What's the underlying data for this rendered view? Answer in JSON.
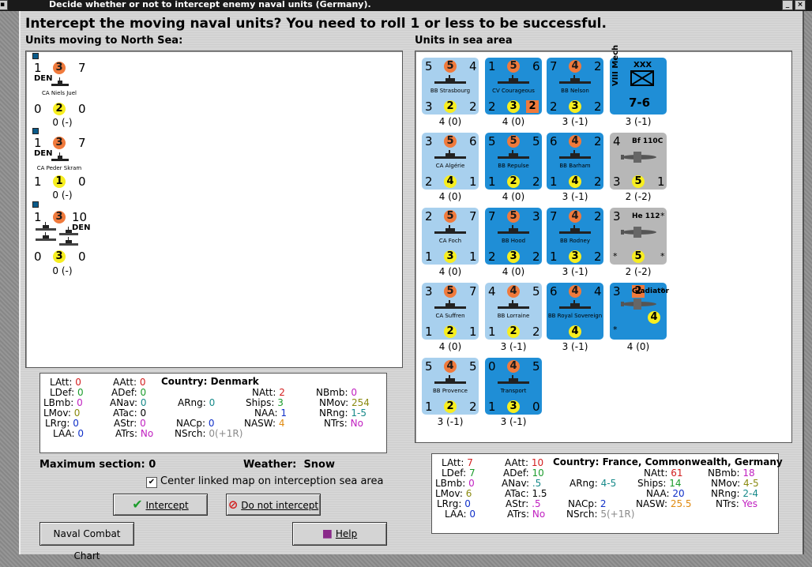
{
  "window": {
    "title": "Decide whether or not to intercept enemy naval units (Germany)."
  },
  "header": {
    "prompt": "Intercept the moving naval units?  You need to roll 1 or less to be successful."
  },
  "left_panel": {
    "label": "Units moving to North Sea:",
    "units": [
      {
        "top": [
          "1",
          "3",
          "7"
        ],
        "flag": "DEN",
        "name": "CA Niels Juel",
        "bottom": [
          "0",
          "2",
          "0"
        ],
        "count": "0 (-)"
      },
      {
        "top": [
          "1",
          "3",
          "7"
        ],
        "flag": "DEN",
        "name": "CA Peder Skram",
        "bottom": [
          "1",
          "1",
          "0"
        ],
        "count": "0 (-)"
      },
      {
        "top": [
          "1",
          "3",
          "10"
        ],
        "flag": "DEN",
        "name": "",
        "bottom": [
          "0",
          "3",
          "0"
        ],
        "count": "0 (-)"
      }
    ]
  },
  "right_panel": {
    "label": "Units in sea area",
    "units": [
      {
        "top": [
          "5",
          "5",
          "4"
        ],
        "name": "BB Strasbourg",
        "bottom": [
          "3",
          "2",
          "2"
        ],
        "count": "4 (0)"
      },
      {
        "top": [
          "1",
          "5",
          "6"
        ],
        "name": "CV Courageous",
        "bottom": [
          "2",
          "3",
          "2"
        ],
        "count": "4 (0)"
      },
      {
        "top": [
          "7",
          "4",
          "2"
        ],
        "name": "BB Nelson",
        "bottom": [
          "2",
          "3",
          "2"
        ],
        "count": "3 (-1)"
      },
      {
        "corps": "XXX",
        "unit": "VIII Mech",
        "strength": "7-6",
        "count": "3 (-1)"
      },
      {
        "top": [
          "3",
          "5",
          "6"
        ],
        "name": "CA Algérie",
        "bottom": [
          "2",
          "4",
          "1"
        ],
        "count": "4 (0)"
      },
      {
        "top": [
          "5",
          "5",
          "5"
        ],
        "name": "BB Repulse",
        "bottom": [
          "1",
          "2",
          "2"
        ],
        "count": "4 (0)"
      },
      {
        "top": [
          "6",
          "4",
          "2"
        ],
        "name": "BB Barham",
        "bottom": [
          "1",
          "4",
          "2"
        ],
        "count": "3 (-1)"
      },
      {
        "top": [
          "4",
          "",
          ""
        ],
        "air": "Bf 110C",
        "bottom": [
          "3",
          "5",
          "1"
        ],
        "count": "2 (-2)"
      },
      {
        "top": [
          "2",
          "5",
          "7"
        ],
        "name": "CA Foch",
        "bottom": [
          "1",
          "3",
          "1"
        ],
        "count": "4 (0)"
      },
      {
        "top": [
          "7",
          "5",
          "3"
        ],
        "name": "BB Hood",
        "bottom": [
          "2",
          "3",
          "2"
        ],
        "count": "4 (0)"
      },
      {
        "top": [
          "7",
          "4",
          "2"
        ],
        "name": "BB Rodney",
        "bottom": [
          "1",
          "3",
          "2"
        ],
        "count": "3 (-1)"
      },
      {
        "top": [
          "3",
          "",
          "*"
        ],
        "air": "He 112",
        "bottom": [
          "*",
          "5",
          "*"
        ],
        "count": "2 (-2)"
      },
      {
        "top": [
          "3",
          "5",
          "7"
        ],
        "name": "CA Suffren",
        "bottom": [
          "1",
          "2",
          "1"
        ],
        "count": "4 (0)"
      },
      {
        "top": [
          "4",
          "4",
          "5"
        ],
        "name": "BB Lorraine",
        "bottom": [
          "1",
          "2",
          "2"
        ],
        "count": "3 (-1)"
      },
      {
        "top": [
          "6",
          "4",
          "4"
        ],
        "name": "BB Royal Sovereign",
        "bottom": [
          "",
          "4",
          ""
        ],
        "count": "3 (-1)"
      },
      {
        "top": [
          "3",
          "2",
          "*"
        ],
        "air": "Gladiator",
        "bottom": [
          "*",
          "4",
          ""
        ],
        "count": "4 (0)"
      },
      {
        "top": [
          "5",
          "4",
          "5"
        ],
        "name": "BB Provence",
        "bottom": [
          "1",
          "2",
          "2"
        ],
        "count": "3 (-1)"
      },
      {
        "top": [
          "0",
          "4",
          "5"
        ],
        "name": "Transport",
        "bottom": [
          "1",
          "3",
          "0"
        ],
        "count": "3 (-1)"
      }
    ]
  },
  "left_stats": {
    "country_label": "Country:",
    "country": "Denmark",
    "rows": [
      [
        "LAtt:",
        "0",
        "AAtt:",
        "0"
      ],
      [
        "LDef:",
        "0",
        "ADef:",
        "0"
      ],
      [
        "LBmb:",
        "0",
        "ANav:",
        "0"
      ],
      [
        "LMov:",
        "0",
        "ATac:",
        "0"
      ],
      [
        "LRrg:",
        "0",
        "AStr:",
        "0"
      ],
      [
        "LAA:",
        "0",
        "ATrs:",
        "No"
      ]
    ],
    "mid": [
      [
        "ARng:",
        "0"
      ],
      [
        "NACp:",
        "0"
      ],
      [
        "NSrch:",
        "0(+1R)"
      ]
    ],
    "naval": [
      [
        "NAtt:",
        "2"
      ],
      [
        "Ships:",
        "3"
      ],
      [
        "NAA:",
        "1"
      ],
      [
        "NASW:",
        "4"
      ]
    ],
    "naval2": [
      [
        "NBmb:",
        "0"
      ],
      [
        "NMov:",
        "254"
      ],
      [
        "NRng:",
        "1-5"
      ],
      [
        "NTrs:",
        "No"
      ]
    ]
  },
  "right_stats": {
    "country_label": "Country:",
    "country": "France, Commonwealth, Germany",
    "rows": [
      [
        "LAtt:",
        "7",
        "AAtt:",
        "10"
      ],
      [
        "LDef:",
        "7",
        "ADef:",
        "10"
      ],
      [
        "LBmb:",
        "0",
        "ANav:",
        ".5"
      ],
      [
        "LMov:",
        "6",
        "ATac:",
        "1.5"
      ],
      [
        "LRrg:",
        "0",
        "AStr:",
        ".5"
      ],
      [
        "LAA:",
        "0",
        "ATrs:",
        "No"
      ]
    ],
    "mid": [
      [
        "ARng:",
        "4-5"
      ],
      [
        "NACp:",
        "2"
      ],
      [
        "NSrch:",
        "5(+1R)"
      ]
    ],
    "naval": [
      [
        "NAtt:",
        "61"
      ],
      [
        "Ships:",
        "14"
      ],
      [
        "NAA:",
        "20"
      ],
      [
        "NASW:",
        "25.5"
      ]
    ],
    "naval2": [
      [
        "NBmb:",
        "18"
      ],
      [
        "NMov:",
        "4-5"
      ],
      [
        "NRng:",
        "2-4"
      ],
      [
        "NTrs:",
        "Yes"
      ]
    ]
  },
  "footer": {
    "max_section": "Maximum section: 0",
    "weather_label": "Weather:",
    "weather": "Snow",
    "center_label": "Center linked map on interception sea area",
    "intercept": "Intercept",
    "no_intercept": "Do not intercept",
    "chart": "Naval Combat Chart",
    "help": "Help"
  }
}
